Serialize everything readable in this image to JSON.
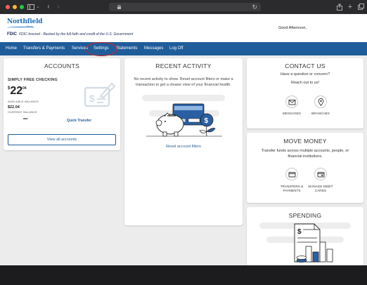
{
  "header": {
    "brand_name": "Northfield",
    "brand_sub": "Bank",
    "fdic_label": "FDIC",
    "fdic_text": "FDIC-Insured - Backed by the full faith and credit of the U.S. Government",
    "greeting": "Good Afternoon,"
  },
  "nav": {
    "items": [
      "Home",
      "Transfers & Payments",
      "Services",
      "Settings",
      "Statements",
      "Messages",
      "Log Off"
    ]
  },
  "accounts": {
    "title": "ACCOUNTS",
    "account_name": "SIMPLY FREE CHECKING",
    "currency": "$",
    "available_dollars": "22",
    "available_cents": "04",
    "available_label": "AVAILABLE BALANCE",
    "current_balance": "$22.04",
    "current_label": "CURRENT BALANCE",
    "more_label": "•••",
    "quick_transfer": "Quick Transfer",
    "view_all": "View all accounts"
  },
  "recent": {
    "title": "RECENT ACTIVITY",
    "empty_text": "No recent activity to show. Reset account filters or make a transaction to get a clearer view of your financial health.",
    "reset_link": "Reset account filters"
  },
  "contact": {
    "title": "CONTACT US",
    "question": "Have a question or concern?",
    "reach": "Reach out to us!",
    "messages_label": "MESSAGES",
    "branches_label": "BRANCHES"
  },
  "move_money": {
    "title": "MOVE MONEY",
    "description": "Transfer funds across multiple accounts, people, or financial institutions.",
    "transfers_label_1": "TRANSFERS &",
    "transfers_label_2": "PAYMENTS",
    "debit_label_1": "MANAGE DEBIT",
    "debit_label_2": "CARDS"
  },
  "spending": {
    "title": "SPENDING"
  },
  "colors": {
    "nav_bg": "#1f5c9a",
    "brand_blue": "#1d6fb8",
    "highlight_red": "#d32222"
  }
}
